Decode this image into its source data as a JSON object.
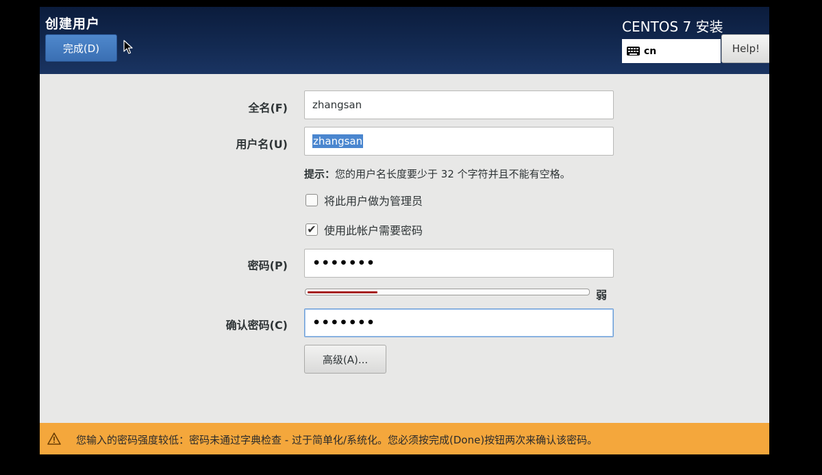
{
  "header": {
    "title": "创建用户",
    "done_label": "完成(D)",
    "product_title": "CENTOS 7 安装",
    "keyboard_layout": "cn",
    "help_label": "Help!"
  },
  "form": {
    "fullname_label": "全名(F)",
    "fullname_value": "zhangsan",
    "username_label": "用户名(U)",
    "username_value": "zhangsan",
    "hint_prefix": "提示：",
    "hint_text": "您的用户名长度要少于 32 个字符并且不能有空格。",
    "admin_checkbox_label": "将此用户做为管理员",
    "admin_checked": false,
    "require_password_label": "使用此帐户需要密码",
    "require_password_checked": true,
    "password_label": "密码(P)",
    "password_mask": "•••••••",
    "strength_label": "弱",
    "strength_level": 0.25,
    "confirm_label": "确认密码(C)",
    "confirm_mask": "•••••••",
    "advanced_label": "高级(A)..."
  },
  "warning": {
    "text": "您输入的密码强度较低：密码未通过字典检查 - 过于简单化/系统化。您必须按完成(Done)按钮两次来确认该密码。"
  },
  "colors": {
    "header_bg": "#132a52",
    "done_button": "#3a6fb3",
    "warning_bg": "#f4a73c",
    "strength_weak": "#a61c1c"
  }
}
